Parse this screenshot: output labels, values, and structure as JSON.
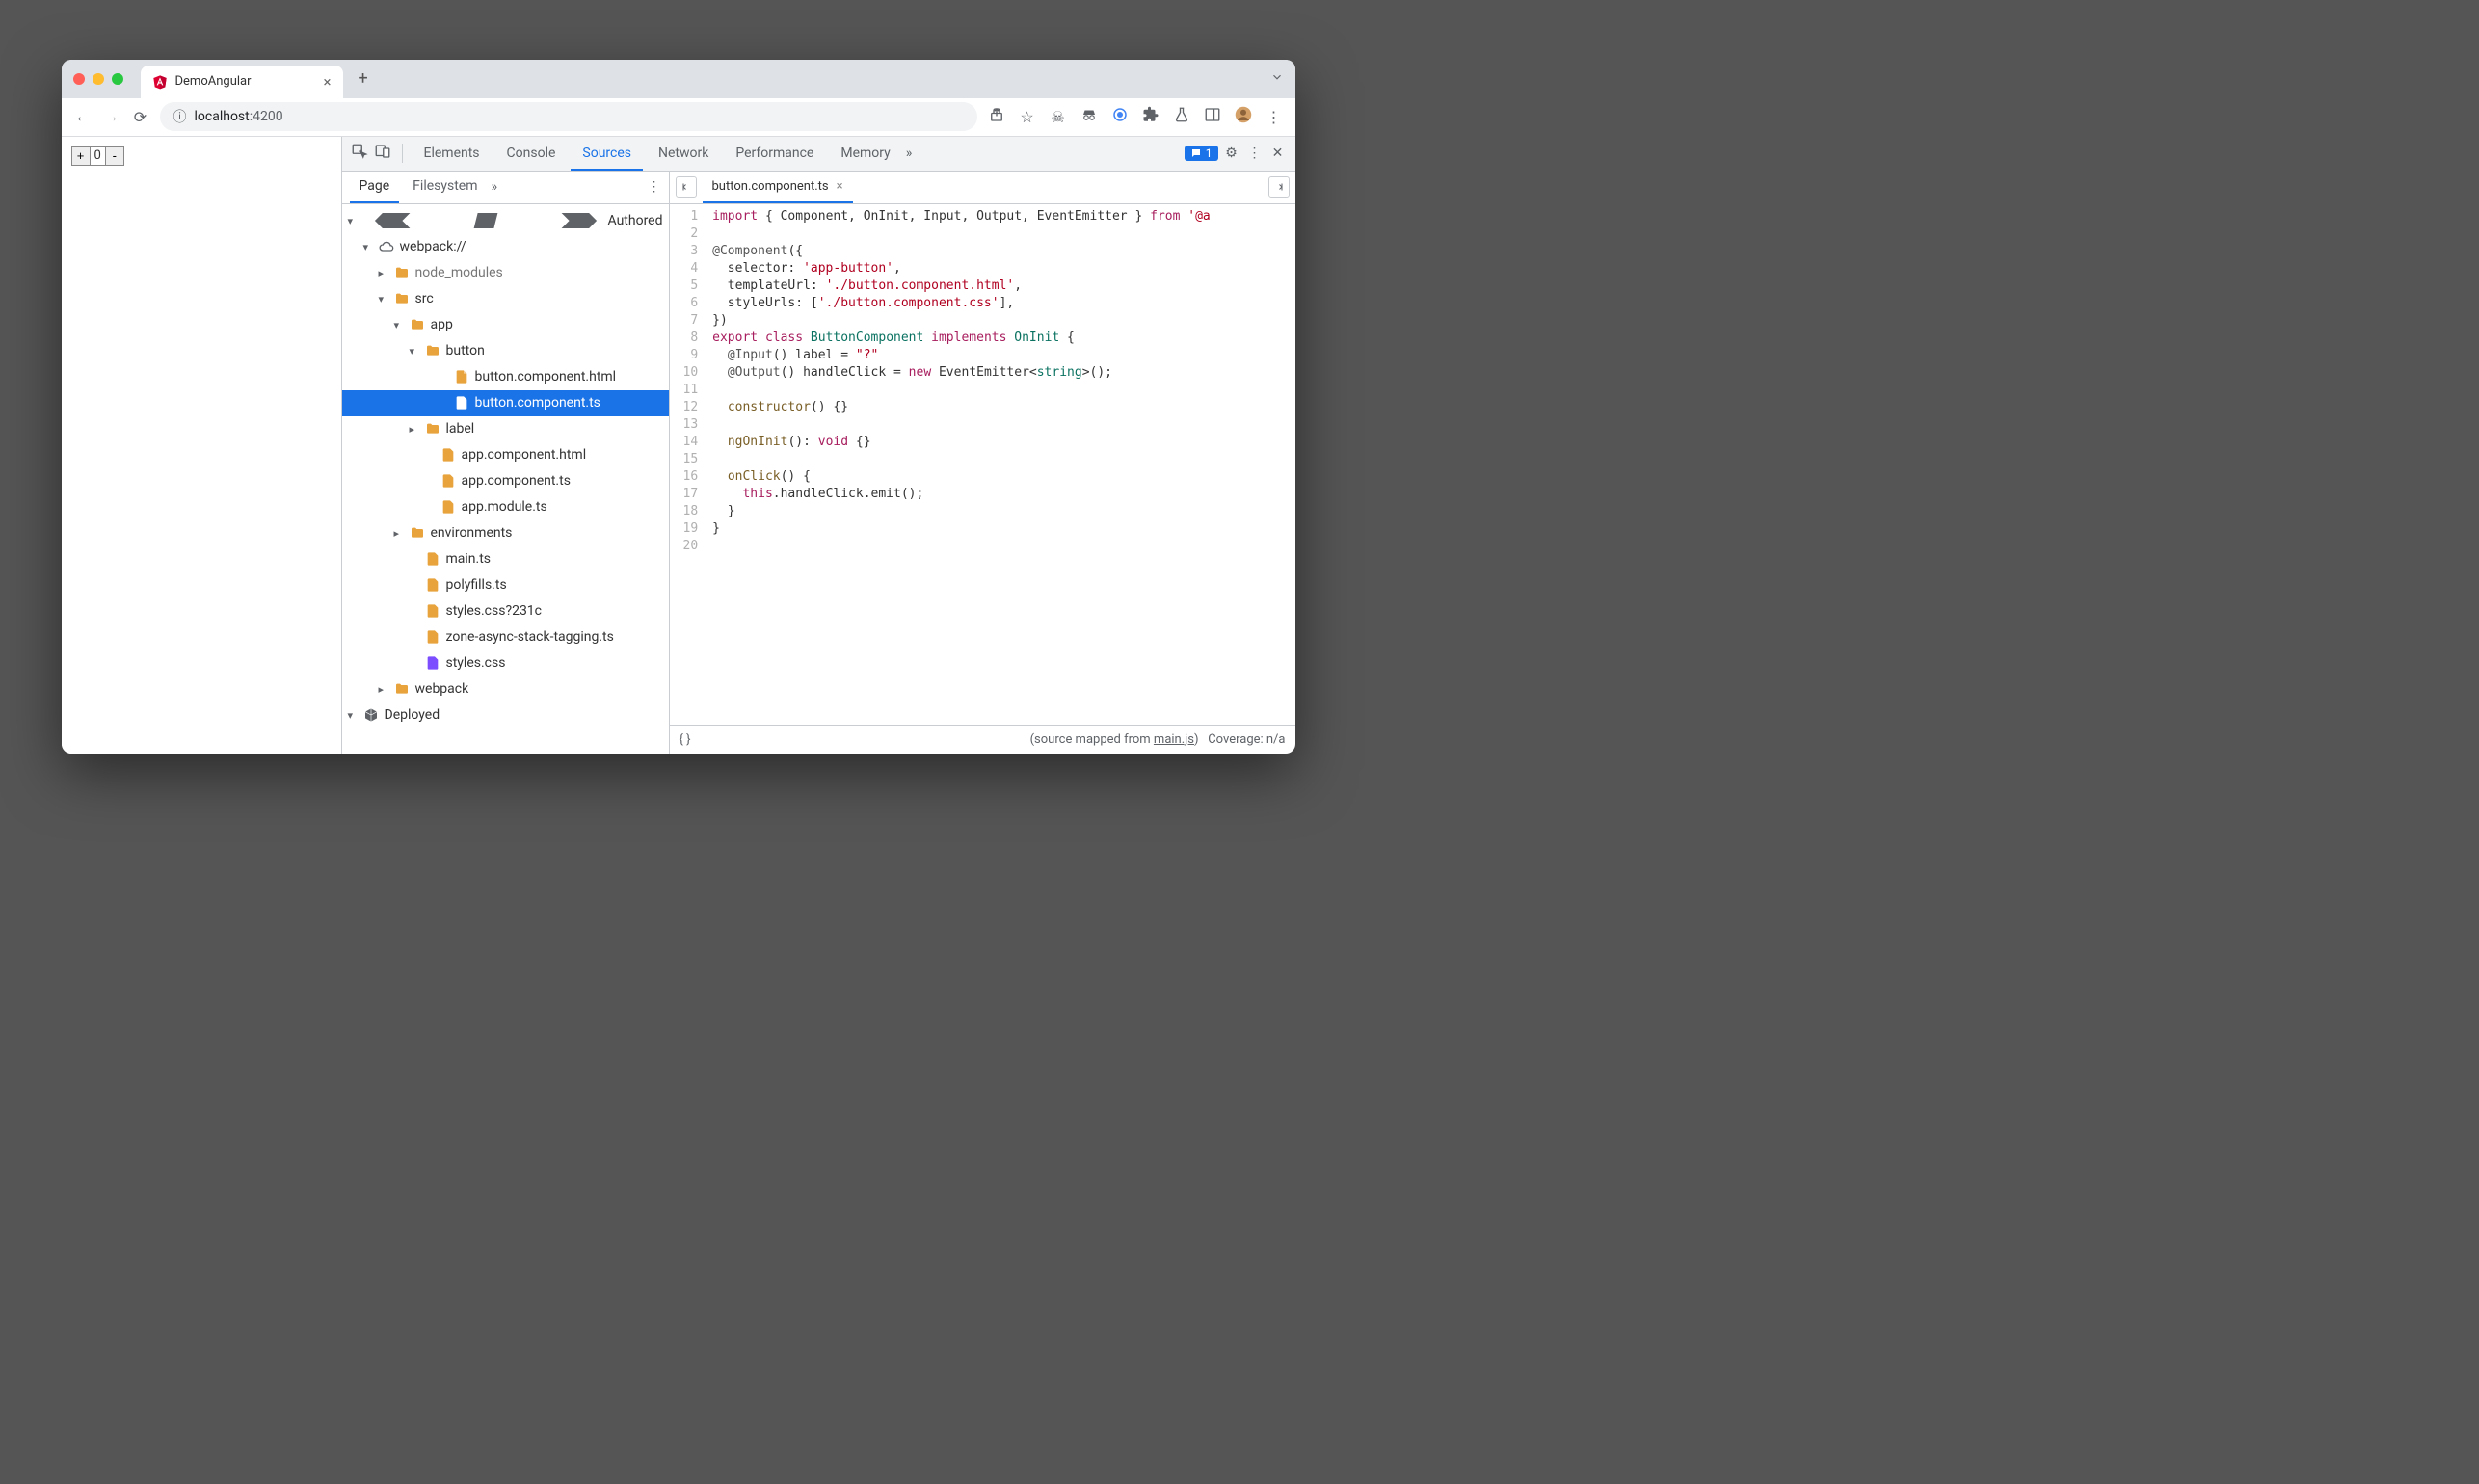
{
  "browser": {
    "tab_title": "DemoAngular",
    "url_host": "localhost",
    "url_port": ":4200",
    "counter_value": "0"
  },
  "devtools": {
    "tabs": [
      "Elements",
      "Console",
      "Sources",
      "Network",
      "Performance",
      "Memory"
    ],
    "active_tab": "Sources",
    "issue_count": "1"
  },
  "navigator": {
    "tabs": [
      "Page",
      "Filesystem"
    ],
    "active": "Page",
    "tree": {
      "authored": "Authored",
      "webpack": "webpack://",
      "node_modules": "node_modules",
      "src": "src",
      "app": "app",
      "button_folder": "button",
      "button_html": "button.component.html",
      "button_ts": "button.component.ts",
      "label_folder": "label",
      "app_html": "app.component.html",
      "app_ts": "app.component.ts",
      "app_module": "app.module.ts",
      "environments": "environments",
      "main_ts": "main.ts",
      "polyfills": "polyfills.ts",
      "styles_q": "styles.css?231c",
      "zone": "zone-async-stack-tagging.ts",
      "styles": "styles.css",
      "webpack_folder": "webpack",
      "deployed": "Deployed"
    }
  },
  "editor": {
    "open_file": "button.component.ts",
    "line_count": 20,
    "code_lines": [
      {
        "n": 1,
        "html": "<span class='c-kw'>import</span> { Component, OnInit, Input, Output, EventEmitter } <span class='c-kw'>from</span> <span class='c-str'>'@a</span>"
      },
      {
        "n": 2,
        "html": ""
      },
      {
        "n": 3,
        "html": "<span class='c-dec'>@Component</span>({"
      },
      {
        "n": 4,
        "html": "  selector: <span class='c-str'>'app-button'</span>,"
      },
      {
        "n": 5,
        "html": "  templateUrl: <span class='c-str'>'./button.component.html'</span>,"
      },
      {
        "n": 6,
        "html": "  styleUrls: [<span class='c-str'>'./button.component.css'</span>],"
      },
      {
        "n": 7,
        "html": "})"
      },
      {
        "n": 8,
        "html": "<span class='c-kw'>export</span> <span class='c-kw'>class</span> <span class='c-cls'>ButtonComponent</span> <span class='c-kw'>implements</span> <span class='c-cls'>OnInit</span> {"
      },
      {
        "n": 9,
        "html": "  <span class='c-dec'>@Input</span>() label = <span class='c-str'>\"?\"</span>"
      },
      {
        "n": 10,
        "html": "  <span class='c-dec'>@Output</span>() handleClick = <span class='c-kw'>new</span> EventEmitter&lt;<span class='c-cls'>string</span>&gt;();"
      },
      {
        "n": 11,
        "html": ""
      },
      {
        "n": 12,
        "html": "  <span class='c-fn'>constructor</span>() {}"
      },
      {
        "n": 13,
        "html": ""
      },
      {
        "n": 14,
        "html": "  <span class='c-fn'>ngOnInit</span>(): <span class='c-kw'>void</span> {}"
      },
      {
        "n": 15,
        "html": ""
      },
      {
        "n": 16,
        "html": "  <span class='c-fn'>onClick</span>() {"
      },
      {
        "n": 17,
        "html": "    <span class='c-kw'>this</span>.handleClick.emit();"
      },
      {
        "n": 18,
        "html": "  }"
      },
      {
        "n": 19,
        "html": "}"
      },
      {
        "n": 20,
        "html": ""
      }
    ]
  },
  "status": {
    "mapped_prefix": "(source mapped from ",
    "mapped_file": "main.js",
    "mapped_suffix": ")",
    "coverage": "Coverage: n/a"
  }
}
